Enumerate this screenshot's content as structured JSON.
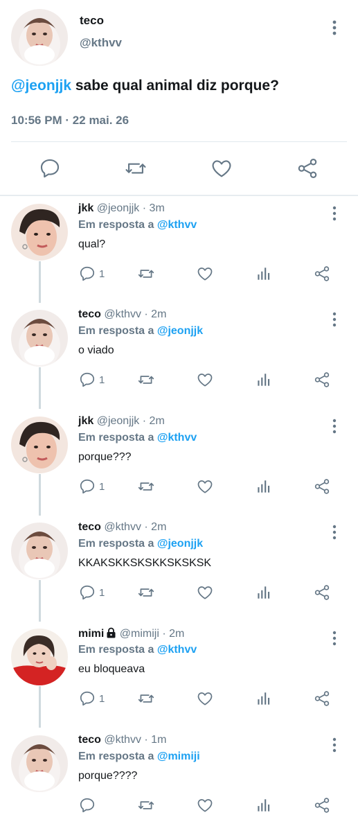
{
  "main_tweet": {
    "author_name": "teco",
    "author_handle": "@kthvv",
    "mention": "@jeonjjk",
    "text": "sabe qual animal diz porque?",
    "timestamp": "10:56 PM · 22 mai. 26"
  },
  "colors": {
    "link": "#1da1f2",
    "secondary_text": "#657786",
    "icon": "#657786",
    "divider": "#e1e8ed"
  },
  "replies": [
    {
      "name": "jkk",
      "handle": "@jeonjjk",
      "time": "· 3m",
      "reply_prefix": "Em resposta a",
      "reply_to": "@kthvv",
      "text": "qual?",
      "reply_count": "1",
      "avatar": "avatar-jkk",
      "locked": false
    },
    {
      "name": "teco",
      "handle": "@kthvv",
      "time": "· 2m",
      "reply_prefix": "Em resposta a",
      "reply_to": "@jeonjjk",
      "text": "o viado",
      "reply_count": "1",
      "avatar": "avatar-teco",
      "locked": false
    },
    {
      "name": "jkk",
      "handle": "@jeonjjk",
      "time": "· 2m",
      "reply_prefix": "Em resposta a",
      "reply_to": "@kthvv",
      "text": "porque???",
      "reply_count": "1",
      "avatar": "avatar-jkk",
      "locked": false
    },
    {
      "name": "teco",
      "handle": "@kthvv",
      "time": "· 2m",
      "reply_prefix": "Em resposta a",
      "reply_to": "@jeonjjk",
      "text": "KKAKSKKSKSKKSKSKSK",
      "reply_count": "1",
      "avatar": "avatar-teco",
      "locked": false
    },
    {
      "name": "mimi",
      "handle": "@mimiji",
      "time": "· 2m",
      "reply_prefix": "Em resposta a",
      "reply_to": "@kthvv",
      "text": "eu bloqueava",
      "reply_count": "1",
      "avatar": "avatar-mimi",
      "locked": true
    },
    {
      "name": "teco",
      "handle": "@kthvv",
      "time": "· 1m",
      "reply_prefix": "Em resposta a",
      "reply_to": "@mimiji",
      "text": "porque????",
      "reply_count": "",
      "avatar": "avatar-teco",
      "locked": false
    }
  ]
}
